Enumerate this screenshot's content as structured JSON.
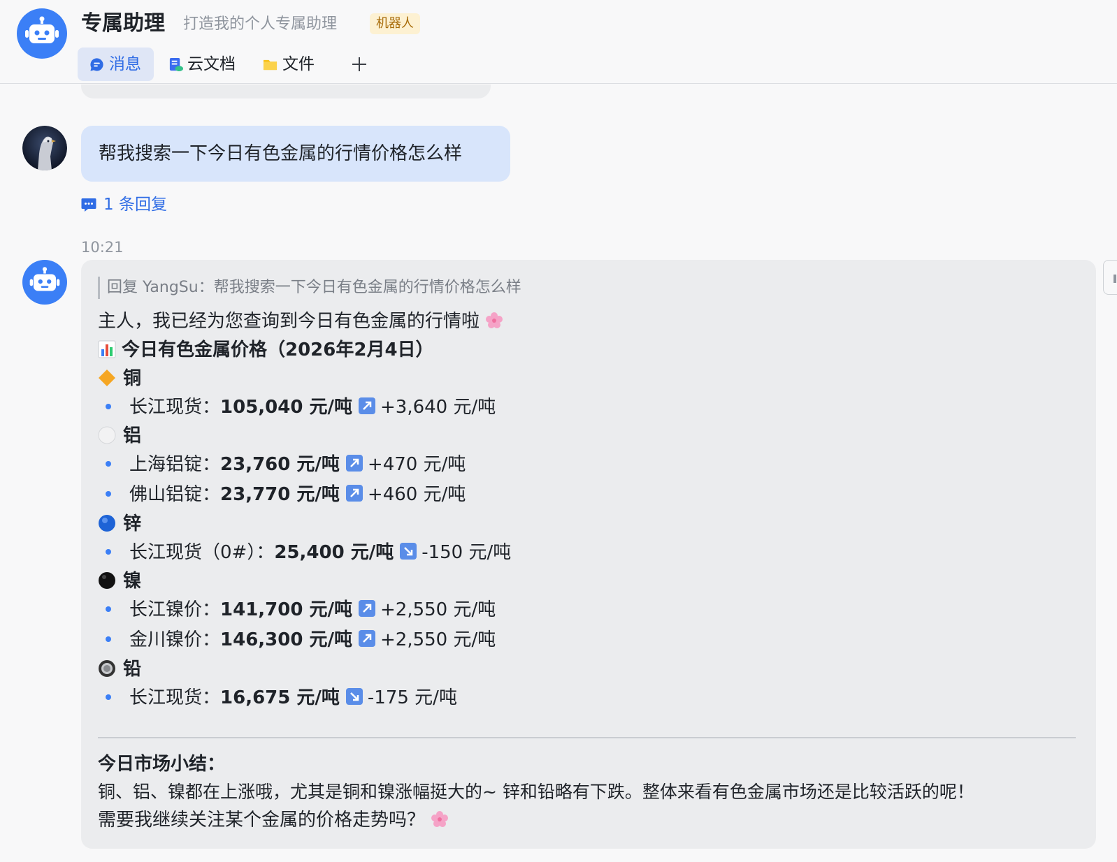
{
  "header": {
    "title": "专属助理",
    "subtitle": "打造我的个人专属助理",
    "badge": "机器人",
    "tabs": [
      {
        "label": "消息",
        "icon": "message-icon",
        "active": true
      },
      {
        "label": "云文档",
        "icon": "cloud-doc-icon",
        "active": false
      },
      {
        "label": "文件",
        "icon": "folder-icon",
        "active": false
      }
    ],
    "add_tab": "+"
  },
  "user_message": {
    "text": "帮我搜索一下今日有色金属的行情价格怎么样",
    "reply_count": "1 条回复"
  },
  "bot_message": {
    "time": "10:21",
    "quote": "回复 YangSu：帮我搜索一下今日有色金属的行情价格怎么样",
    "greeting": "主人，我已经为您查询到今日有色金属的行情啦",
    "heading": "今日有色金属价格（2026年2月4日）",
    "metals": [
      {
        "name": "铜",
        "icon": "orange-diamond-icon",
        "items": [
          {
            "label": "长江现货：",
            "price": "105,040 元/吨",
            "trend": "up",
            "change": "+3,640 元/吨"
          }
        ]
      },
      {
        "name": "铝",
        "icon": "white-circle-icon",
        "items": [
          {
            "label": "上海铝锭：",
            "price": "23,760 元/吨",
            "trend": "up",
            "change": "+470 元/吨"
          },
          {
            "label": "佛山铝锭：",
            "price": "23,770 元/吨",
            "trend": "up",
            "change": "+460 元/吨"
          }
        ]
      },
      {
        "name": "锌",
        "icon": "blue-circle-icon",
        "items": [
          {
            "label": "长江现货（0#）：",
            "price": "25,400 元/吨",
            "trend": "down",
            "change": "-150 元/吨"
          }
        ]
      },
      {
        "name": "镍",
        "icon": "black-circle-icon",
        "items": [
          {
            "label": "长江镍价：",
            "price": "141,700 元/吨",
            "trend": "up",
            "change": "+2,550 元/吨"
          },
          {
            "label": "金川镍价：",
            "price": "146,300 元/吨",
            "trend": "up",
            "change": "+2,550 元/吨"
          }
        ]
      },
      {
        "name": "铅",
        "icon": "radio-button-icon",
        "items": [
          {
            "label": "长江现货：",
            "price": "16,675 元/吨",
            "trend": "down",
            "change": "-175 元/吨"
          }
        ]
      }
    ],
    "summary_title": "今日市场小结：",
    "summary_line1": "铜、铝、镍都在上涨哦，尤其是铜和镍涨幅挺大的~ 锌和铅略有下跌。整体来看有色金属市场还是比较活跃的呢！",
    "summary_line2": "需要我继续关注某个金属的价格走势吗？"
  },
  "colors": {
    "accent": "#3b7ff6",
    "link": "#2f6ce5",
    "user_bubble": "#d8e5fb",
    "bot_bubble": "#ebecee",
    "badge_bg": "#fdf1d2",
    "badge_text": "#a86c0a"
  }
}
